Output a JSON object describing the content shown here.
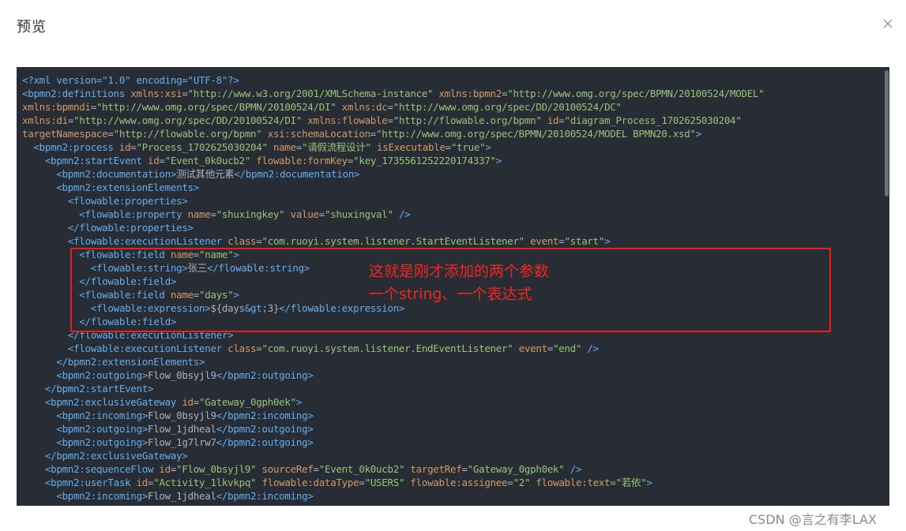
{
  "dialog": {
    "title": "预览",
    "close_icon": "close-icon"
  },
  "code": {
    "lines": [
      [
        [
          "pi",
          "<?xml version=\"1.0\" encoding=\"UTF-8\"?>"
        ]
      ],
      [
        [
          "tag",
          "<bpmn2:definitions "
        ],
        [
          "attr",
          "xmlns:xsi"
        ],
        [
          "txt",
          "="
        ],
        [
          "str",
          "\"http://www.w3.org/2001/XMLSchema-instance\""
        ],
        [
          "txt",
          " "
        ],
        [
          "attr",
          "xmlns:bpmn2"
        ],
        [
          "txt",
          "="
        ],
        [
          "str",
          "\"http://www.omg.org/spec/BPMN/20100524/MODEL\""
        ]
      ],
      [
        [
          "attr",
          "xmlns:bpmndi"
        ],
        [
          "txt",
          "="
        ],
        [
          "str",
          "\"http://www.omg.org/spec/BPMN/20100524/DI\""
        ],
        [
          "txt",
          " "
        ],
        [
          "attr",
          "xmlns:dc"
        ],
        [
          "txt",
          "="
        ],
        [
          "str",
          "\"http://www.omg.org/spec/DD/20100524/DC\""
        ]
      ],
      [
        [
          "attr",
          "xmlns:di"
        ],
        [
          "txt",
          "="
        ],
        [
          "str",
          "\"http://www.omg.org/spec/DD/20100524/DI\""
        ],
        [
          "txt",
          " "
        ],
        [
          "attr",
          "xmlns:flowable"
        ],
        [
          "txt",
          "="
        ],
        [
          "str",
          "\"http://flowable.org/bpmn\""
        ],
        [
          "txt",
          " "
        ],
        [
          "attr",
          "id"
        ],
        [
          "txt",
          "="
        ],
        [
          "str",
          "\"diagram_Process_1702625030204\""
        ]
      ],
      [
        [
          "attr",
          "targetNamespace"
        ],
        [
          "txt",
          "="
        ],
        [
          "str",
          "\"http://flowable.org/bpmn\""
        ],
        [
          "txt",
          " "
        ],
        [
          "attr",
          "xsi:schemaLocation"
        ],
        [
          "txt",
          "="
        ],
        [
          "str",
          "\"http://www.omg.org/spec/BPMN/20100524/MODEL BPMN20.xsd\""
        ],
        [
          "tag",
          ">"
        ]
      ],
      [
        [
          "txt",
          "  "
        ],
        [
          "tag",
          "<bpmn2:process "
        ],
        [
          "attr",
          "id"
        ],
        [
          "txt",
          "="
        ],
        [
          "str",
          "\"Process_1702625030204\""
        ],
        [
          "txt",
          " "
        ],
        [
          "attr",
          "name"
        ],
        [
          "txt",
          "="
        ],
        [
          "str",
          "\"请假流程设计\""
        ],
        [
          "txt",
          " "
        ],
        [
          "attr",
          "isExecutable"
        ],
        [
          "txt",
          "="
        ],
        [
          "str",
          "\"true\""
        ],
        [
          "tag",
          ">"
        ]
      ],
      [
        [
          "txt",
          "    "
        ],
        [
          "tag",
          "<bpmn2:startEvent "
        ],
        [
          "attr",
          "id"
        ],
        [
          "txt",
          "="
        ],
        [
          "str",
          "\"Event_0k0ucb2\""
        ],
        [
          "txt",
          " "
        ],
        [
          "attr",
          "flowable:formKey"
        ],
        [
          "txt",
          "="
        ],
        [
          "str",
          "\"key_1735561252220174337\""
        ],
        [
          "tag",
          ">"
        ]
      ],
      [
        [
          "txt",
          "      "
        ],
        [
          "tag",
          "<bpmn2:documentation>"
        ],
        [
          "txt",
          "测试其他元素"
        ],
        [
          "tag",
          "</bpmn2:documentation>"
        ]
      ],
      [
        [
          "txt",
          "      "
        ],
        [
          "tag",
          "<bpmn2:extensionElements>"
        ]
      ],
      [
        [
          "txt",
          "        "
        ],
        [
          "tag",
          "<flowable:properties>"
        ]
      ],
      [
        [
          "txt",
          "          "
        ],
        [
          "tag",
          "<flowable:property "
        ],
        [
          "attr",
          "name"
        ],
        [
          "txt",
          "="
        ],
        [
          "str",
          "\"shuxingkey\""
        ],
        [
          "txt",
          " "
        ],
        [
          "attr",
          "value"
        ],
        [
          "txt",
          "="
        ],
        [
          "str",
          "\"shuxingval\""
        ],
        [
          "txt",
          " "
        ],
        [
          "tag",
          "/>"
        ]
      ],
      [
        [
          "txt",
          "        "
        ],
        [
          "tag",
          "</flowable:properties>"
        ]
      ],
      [
        [
          "txt",
          "        "
        ],
        [
          "tag",
          "<flowable:executionListener "
        ],
        [
          "attr",
          "class"
        ],
        [
          "txt",
          "="
        ],
        [
          "str",
          "\"com.ruoyi.system.listener.StartEventListener\""
        ],
        [
          "txt",
          " "
        ],
        [
          "attr",
          "event"
        ],
        [
          "txt",
          "="
        ],
        [
          "str",
          "\"start\""
        ],
        [
          "tag",
          ">"
        ]
      ],
      [
        [
          "txt",
          "          "
        ],
        [
          "tag",
          "<flowable:field "
        ],
        [
          "attr",
          "name"
        ],
        [
          "txt",
          "="
        ],
        [
          "str",
          "\"name\""
        ],
        [
          "tag",
          ">"
        ]
      ],
      [
        [
          "txt",
          "            "
        ],
        [
          "tag",
          "<flowable:string>"
        ],
        [
          "txt",
          "张三"
        ],
        [
          "tag",
          "</flowable:string>"
        ]
      ],
      [
        [
          "txt",
          "          "
        ],
        [
          "tag",
          "</flowable:field>"
        ]
      ],
      [
        [
          "txt",
          "          "
        ],
        [
          "tag",
          "<flowable:field "
        ],
        [
          "attr",
          "name"
        ],
        [
          "txt",
          "="
        ],
        [
          "str",
          "\"days\""
        ],
        [
          "tag",
          ">"
        ]
      ],
      [
        [
          "txt",
          "            "
        ],
        [
          "tag",
          "<flowable:expression>"
        ],
        [
          "txt",
          "${days"
        ],
        [
          "ent",
          "&gt;"
        ],
        [
          "txt",
          "3}"
        ],
        [
          "tag",
          "</flowable:expression>"
        ]
      ],
      [
        [
          "txt",
          "          "
        ],
        [
          "tag",
          "</flowable:field>"
        ]
      ],
      [
        [
          "txt",
          "        "
        ],
        [
          "tag",
          "</flowable:executionListener>"
        ]
      ],
      [
        [
          "txt",
          "        "
        ],
        [
          "tag",
          "<flowable:executionListener "
        ],
        [
          "attr",
          "class"
        ],
        [
          "txt",
          "="
        ],
        [
          "str",
          "\"com.ruoyi.system.listener.EndEventListener\""
        ],
        [
          "txt",
          " "
        ],
        [
          "attr",
          "event"
        ],
        [
          "txt",
          "="
        ],
        [
          "str",
          "\"end\""
        ],
        [
          "txt",
          " "
        ],
        [
          "tag",
          "/>"
        ]
      ],
      [
        [
          "txt",
          "      "
        ],
        [
          "tag",
          "</bpmn2:extensionElements>"
        ]
      ],
      [
        [
          "txt",
          "      "
        ],
        [
          "tag",
          "<bpmn2:outgoing>"
        ],
        [
          "txt",
          "Flow_0bsyjl9"
        ],
        [
          "tag",
          "</bpmn2:outgoing>"
        ]
      ],
      [
        [
          "txt",
          "    "
        ],
        [
          "tag",
          "</bpmn2:startEvent>"
        ]
      ],
      [
        [
          "txt",
          "    "
        ],
        [
          "tag",
          "<bpmn2:exclusiveGateway "
        ],
        [
          "attr",
          "id"
        ],
        [
          "txt",
          "="
        ],
        [
          "str",
          "\"Gateway_0gph0ek\""
        ],
        [
          "tag",
          ">"
        ]
      ],
      [
        [
          "txt",
          "      "
        ],
        [
          "tag",
          "<bpmn2:incoming>"
        ],
        [
          "txt",
          "Flow_0bsyjl9"
        ],
        [
          "tag",
          "</bpmn2:incoming>"
        ]
      ],
      [
        [
          "txt",
          "      "
        ],
        [
          "tag",
          "<bpmn2:outgoing>"
        ],
        [
          "txt",
          "Flow_1jdheal"
        ],
        [
          "tag",
          "</bpmn2:outgoing>"
        ]
      ],
      [
        [
          "txt",
          "      "
        ],
        [
          "tag",
          "<bpmn2:outgoing>"
        ],
        [
          "txt",
          "Flow_1g7lrw7"
        ],
        [
          "tag",
          "</bpmn2:outgoing>"
        ]
      ],
      [
        [
          "txt",
          "    "
        ],
        [
          "tag",
          "</bpmn2:exclusiveGateway>"
        ]
      ],
      [
        [
          "txt",
          "    "
        ],
        [
          "tag",
          "<bpmn2:sequenceFlow "
        ],
        [
          "attr",
          "id"
        ],
        [
          "txt",
          "="
        ],
        [
          "str",
          "\"Flow_0bsyjl9\""
        ],
        [
          "txt",
          " "
        ],
        [
          "attr",
          "sourceRef"
        ],
        [
          "txt",
          "="
        ],
        [
          "str",
          "\"Event_0k0ucb2\""
        ],
        [
          "txt",
          " "
        ],
        [
          "attr",
          "targetRef"
        ],
        [
          "txt",
          "="
        ],
        [
          "str",
          "\"Gateway_0gph0ek\""
        ],
        [
          "txt",
          " "
        ],
        [
          "tag",
          "/>"
        ]
      ],
      [
        [
          "txt",
          "    "
        ],
        [
          "tag",
          "<bpmn2:userTask "
        ],
        [
          "attr",
          "id"
        ],
        [
          "txt",
          "="
        ],
        [
          "str",
          "\"Activity_1lkvkpq\""
        ],
        [
          "txt",
          " "
        ],
        [
          "attr",
          "flowable:dataType"
        ],
        [
          "txt",
          "="
        ],
        [
          "str",
          "\"USERS\""
        ],
        [
          "txt",
          " "
        ],
        [
          "attr",
          "flowable:assignee"
        ],
        [
          "txt",
          "="
        ],
        [
          "str",
          "\"2\""
        ],
        [
          "txt",
          " "
        ],
        [
          "attr",
          "flowable:text"
        ],
        [
          "txt",
          "="
        ],
        [
          "str",
          "\"若依\""
        ],
        [
          "tag",
          ">"
        ]
      ],
      [
        [
          "txt",
          "      "
        ],
        [
          "tag",
          "<bpmn2:incoming>"
        ],
        [
          "txt",
          "Flow_1jdheal"
        ],
        [
          "tag",
          "</bpmn2:incoming>"
        ]
      ]
    ]
  },
  "annotation": {
    "line1": "这就是刚才添加的两个参数",
    "line2": "一个string、一个表达式"
  },
  "watermark": "CSDN @言之有李LAX",
  "colors": {
    "code_bg": "#282c34",
    "tag": "#61afef",
    "attr": "#d19a66",
    "string": "#98c379",
    "text": "#abb2bf",
    "highlight": "#e8201c"
  }
}
